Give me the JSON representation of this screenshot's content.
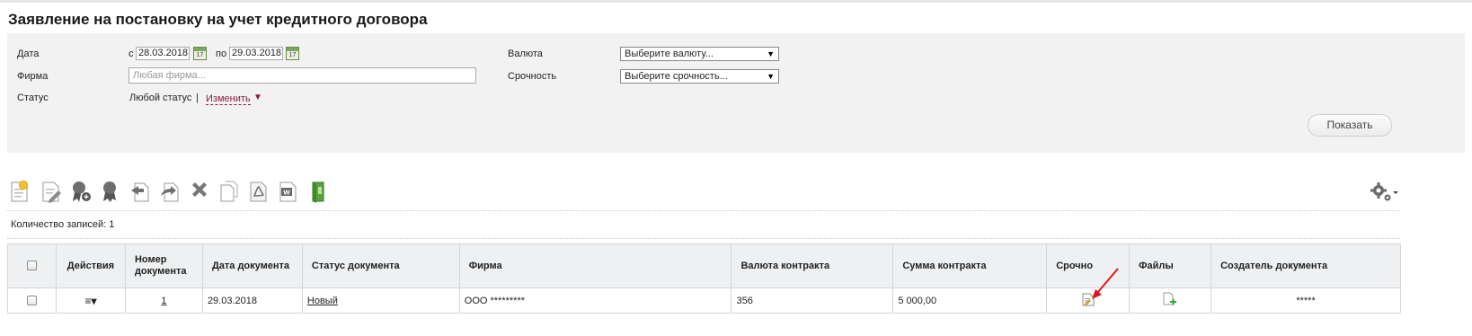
{
  "page": {
    "title": "Заявление на постановку на учет кредитного договора"
  },
  "filters": {
    "date_label": "Дата",
    "date_from_prefix": "с",
    "date_from": "28.03.2018",
    "date_to_prefix": "по",
    "date_to": "29.03.2018",
    "calendar_day": "17",
    "firm_label": "Фирма",
    "firm_placeholder": "Любая фирма...",
    "status_label": "Статус",
    "status_value": "Любой статус",
    "status_separator": "|",
    "status_change": "Изменить",
    "currency_label": "Валюта",
    "currency_select": "Выберите валюту...",
    "urgency_label": "Срочность",
    "urgency_select": "Выберите срочность...",
    "show_button": "Показать"
  },
  "toolbar": {
    "icons": [
      "new-document-icon",
      "edit-document-icon",
      "add-signature-icon",
      "signature-icon",
      "send-icon",
      "withdraw-icon",
      "delete-icon",
      "copy-icon",
      "export-pdf-icon",
      "export-word-icon",
      "archive-book-icon"
    ],
    "settings_icon": "gear-icon"
  },
  "records": {
    "count_text": "Количество записей: 1"
  },
  "table": {
    "columns": [
      "",
      "Действия",
      "Номер документа",
      "Дата документа",
      "Статус документа",
      "Фирма",
      "Валюта контракта",
      "Сумма контракта",
      "Срочно",
      "Файлы",
      "Создатель документа"
    ],
    "rows": [
      {
        "actions_icon": "≡▾",
        "number": "1",
        "date": "29.03.2018",
        "status": "Новый",
        "firm": "ООО *********",
        "currency": "356",
        "amount": "5 000,00",
        "urgent_icon": "document-edit-icon",
        "files_icon": "add-file-icon",
        "creator": "*****"
      }
    ]
  },
  "colors": {
    "accent_link": "#8b1a3a",
    "panel_bg": "#f2f2f2",
    "header_bg": "#eef0f2",
    "annotation_arrow": "#e0141e"
  }
}
